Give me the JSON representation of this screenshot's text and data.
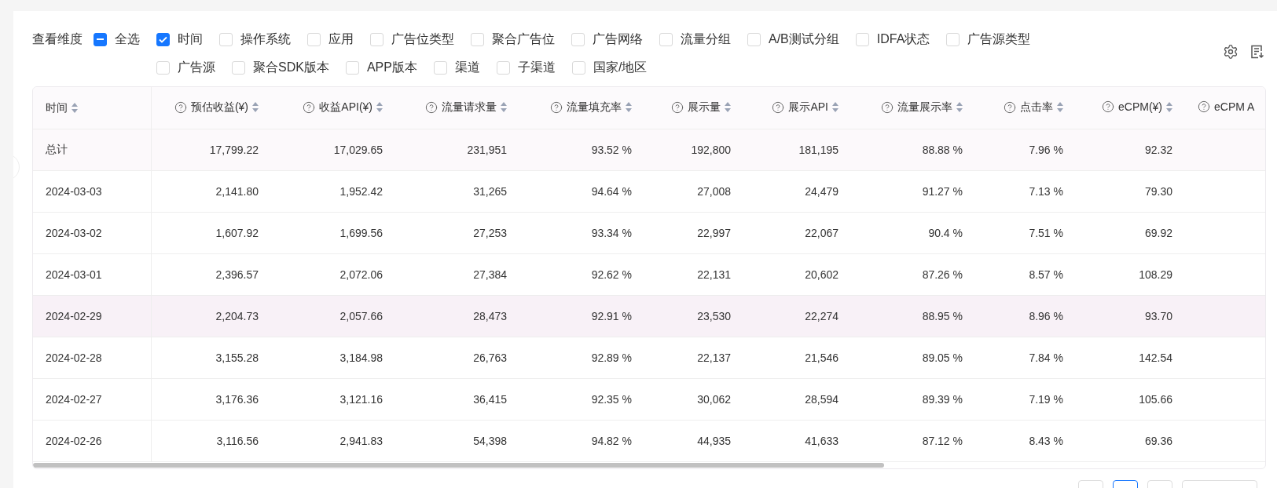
{
  "filter": {
    "label": "查看维度",
    "select_all": {
      "label": "全选",
      "indeterminate": true
    },
    "options": [
      {
        "label": "时间",
        "checked": true
      },
      {
        "label": "操作系统",
        "checked": false
      },
      {
        "label": "应用",
        "checked": false
      },
      {
        "label": "广告位类型",
        "checked": false
      },
      {
        "label": "聚合广告位",
        "checked": false
      },
      {
        "label": "广告网络",
        "checked": false
      },
      {
        "label": "流量分组",
        "checked": false
      },
      {
        "label": "A/B测试分组",
        "checked": false
      },
      {
        "label": "IDFA状态",
        "checked": false
      },
      {
        "label": "广告源类型",
        "checked": false
      },
      {
        "label": "广告源",
        "checked": false
      },
      {
        "label": "聚合SDK版本",
        "checked": false
      },
      {
        "label": "APP版本",
        "checked": false
      },
      {
        "label": "渠道",
        "checked": false
      },
      {
        "label": "子渠道",
        "checked": false
      },
      {
        "label": "国家/地区",
        "checked": false
      }
    ]
  },
  "table": {
    "columns": [
      {
        "label": "时间",
        "help": false
      },
      {
        "label": "预估收益(¥)",
        "help": true
      },
      {
        "label": "收益API(¥)",
        "help": true
      },
      {
        "label": "流量请求量",
        "help": true
      },
      {
        "label": "流量填充率",
        "help": true
      },
      {
        "label": "展示量",
        "help": true
      },
      {
        "label": "展示API",
        "help": true
      },
      {
        "label": "流量展示率",
        "help": true
      },
      {
        "label": "点击率",
        "help": true
      },
      {
        "label": "eCPM(¥)",
        "help": true
      },
      {
        "label": "eCPM A",
        "help": true
      }
    ],
    "rows": [
      {
        "kind": "total",
        "cells": [
          "总计",
          "17,799.22",
          "17,029.65",
          "231,951",
          "93.52 %",
          "192,800",
          "181,195",
          "88.88 %",
          "7.96 %",
          "92.32"
        ]
      },
      {
        "kind": "data",
        "hovered": false,
        "cells": [
          "2024-03-03",
          "2,141.80",
          "1,952.42",
          "31,265",
          "94.64 %",
          "27,008",
          "24,479",
          "91.27 %",
          "7.13 %",
          "79.30"
        ]
      },
      {
        "kind": "data",
        "hovered": false,
        "cells": [
          "2024-03-02",
          "1,607.92",
          "1,699.56",
          "27,253",
          "93.34 %",
          "22,997",
          "22,067",
          "90.4 %",
          "7.51 %",
          "69.92"
        ]
      },
      {
        "kind": "data",
        "hovered": false,
        "cells": [
          "2024-03-01",
          "2,396.57",
          "2,072.06",
          "27,384",
          "92.62 %",
          "22,131",
          "20,602",
          "87.26 %",
          "8.57 %",
          "108.29"
        ]
      },
      {
        "kind": "data",
        "hovered": true,
        "cells": [
          "2024-02-29",
          "2,204.73",
          "2,057.66",
          "28,473",
          "92.91 %",
          "23,530",
          "22,274",
          "88.95 %",
          "8.96 %",
          "93.70"
        ]
      },
      {
        "kind": "data",
        "hovered": false,
        "cells": [
          "2024-02-28",
          "3,155.28",
          "3,184.98",
          "26,763",
          "92.89 %",
          "22,137",
          "21,546",
          "89.05 %",
          "7.84 %",
          "142.54"
        ]
      },
      {
        "kind": "data",
        "hovered": false,
        "cells": [
          "2024-02-27",
          "3,176.36",
          "3,121.16",
          "36,415",
          "92.35 %",
          "30,062",
          "28,594",
          "89.39 %",
          "7.19 %",
          "105.66"
        ]
      },
      {
        "kind": "data",
        "hovered": false,
        "cells": [
          "2024-02-26",
          "3,116.56",
          "2,941.83",
          "54,398",
          "94.82 %",
          "44,935",
          "41,633",
          "87.12 %",
          "8.43 %",
          "69.36"
        ]
      }
    ]
  },
  "pagination": {
    "pages": [
      {
        "selected": false
      },
      {
        "selected": true
      },
      {
        "selected": false
      }
    ]
  }
}
